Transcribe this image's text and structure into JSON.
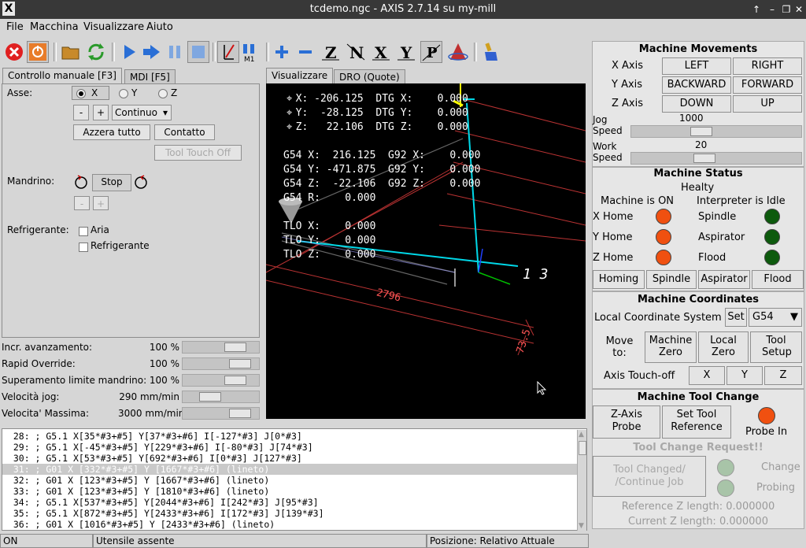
{
  "window": {
    "title": "tcdemo.ngc - AXIS 2.7.14 su my-mill",
    "logo": "X"
  },
  "menu": [
    "File",
    "Macchina",
    "Visualizzare",
    "Aiuto"
  ],
  "left_tabs": [
    "Controllo manuale [F3]",
    "MDI [F5]"
  ],
  "manual": {
    "axis_label": "Asse:",
    "axes": [
      "X",
      "Y",
      "Z"
    ],
    "selected_axis": "X",
    "minus": "-",
    "plus": "+",
    "jog_mode": "Continuo",
    "zero_all": "Azzera tutto",
    "touch": "Contatto",
    "tool_touch_off": "Tool Touch Off",
    "spindle_label": "Mandrino:",
    "spindle_stop": "Stop",
    "coolant_label": "Refrigerante:",
    "mist": "Aria",
    "flood": "Refrigerante"
  },
  "overrides": [
    {
      "label": "Incr. avanzamento:",
      "value": "100 %",
      "level": 0.77
    },
    {
      "label": "Rapid Override:",
      "value": "100 %",
      "level": 0.85
    },
    {
      "label": "Superamento limite mandrino:",
      "value": "100 %",
      "level": 0.77
    },
    {
      "label": "Velocità jog:",
      "value": "290 mm/min",
      "level": 0.3
    },
    {
      "label": "Velocita' Massima:",
      "value": "3000 mm/min",
      "level": 0.85
    }
  ],
  "view_tabs": [
    "Visualizzare",
    "DRO (Quote)"
  ],
  "dro": [
    "  X: -206.125  DTG X:    0.000",
    "  Y:  -28.125  DTG Y:    0.000",
    "  Z:   22.106  DTG Z:    0.000",
    "",
    "G54 X:  216.125  G92 X:    0.000",
    "G54 Y: -471.875  G92 Y:    0.000",
    "G54 Z:  -22.106  G92 Z:    0.000",
    "G54 R:    0.000",
    "",
    "TLO X:    0.000",
    "TLO Y:    0.000",
    "TLO Z:    0.000"
  ],
  "view_labels": {
    "dim_x": "2796",
    "dim_y": "73.5",
    "path_label": "1 3"
  },
  "gcode": [
    "  28: ; G5.1 X[35*#3+#5] Y[37*#3+#6] I[-127*#3] J[0*#3]",
    "  29: ; G5.1 X[-45*#3+#5] Y[229*#3+#6] I[-80*#3] J[74*#3]",
    "  30: ; G5.1 X[53*#3+#5] Y[692*#3+#6] I[0*#3] J[127*#3]",
    "  31: ; G01 X [332*#3+#5] Y [1667*#3+#6] (lineto)",
    "  32: ; G01 X [123*#3+#5] Y [1667*#3+#6] (lineto)",
    "  33: ; G01 X [123*#3+#5] Y [1810*#3+#6] (lineto)",
    "  34: ; G5.1 X[537*#3+#5] Y[2044*#3+#6] I[242*#3] J[95*#3]",
    "  35: ; G5.1 X[872*#3+#5] Y[2433*#3+#6] I[172*#3] J[139*#3]",
    "  36: ; G01 X [1016*#3+#5] Y [2433*#3+#6] (lineto)"
  ],
  "gcode_selected_index": 3,
  "status": {
    "state": "ON",
    "tool": "Utensile assente",
    "position": "Posizione: Relativo Attuale"
  },
  "machine_movements": {
    "title": "Machine Movements",
    "rows": [
      {
        "axis": "X Axis",
        "neg": "LEFT",
        "pos": "RIGHT"
      },
      {
        "axis": "Y Axis",
        "neg": "BACKWARD",
        "pos": "FORWARD"
      },
      {
        "axis": "Z Axis",
        "neg": "DOWN",
        "pos": "UP"
      }
    ],
    "jog_speed_label": "Jog Speed",
    "jog_speed": "1000",
    "jog_level": 0.4,
    "work_speed_label": "Work Speed",
    "work_speed": "20",
    "work_level": 0.42
  },
  "machine_status": {
    "title": "Machine Status",
    "health": "Healty",
    "machine_on": "Machine is ON",
    "interp": "Interpreter is Idle",
    "leds": [
      {
        "label": "X Home",
        "color": "#f05010"
      },
      {
        "label": "Y Home",
        "color": "#f05010"
      },
      {
        "label": "Z Home",
        "color": "#f05010"
      },
      {
        "label": "Spindle",
        "color": "#0d5a0d"
      },
      {
        "label": "Aspirator",
        "color": "#0d5a0d"
      },
      {
        "label": "Flood",
        "color": "#0d5a0d"
      }
    ],
    "buttons": [
      "Homing",
      "Spindle",
      "Aspirator",
      "Flood"
    ]
  },
  "machine_coords": {
    "title": "Machine Coordinates",
    "lcs_label": "Local Coordinate System",
    "set": "Set",
    "lcs_value": "G54",
    "move_to": "Move to:",
    "machine_zero": "Machine Zero",
    "local_zero": "Local Zero",
    "tool_setup": "Tool Setup",
    "touch_off": "Axis Touch-off",
    "axes": [
      "X",
      "Y",
      "Z"
    ]
  },
  "tool_change": {
    "title": "Machine Tool Change",
    "z_probe": "Z-Axis Probe",
    "set_ref": "Set Tool Reference",
    "probe_in": "Probe In",
    "probe_color": "#f05010",
    "request": "Tool Change Request!!",
    "changed": "Tool Changed/ /Continue Job",
    "change": "Change",
    "probing": "Probing",
    "ref_z": "Reference Z length: 0.000000",
    "cur_z": "Current Z length: 0.000000"
  }
}
